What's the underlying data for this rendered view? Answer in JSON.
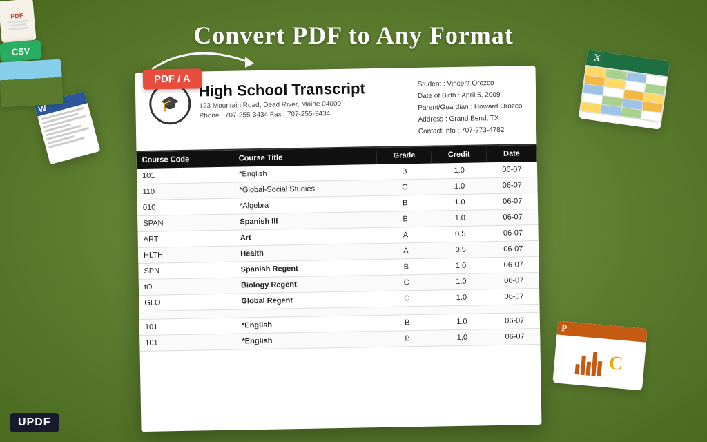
{
  "page": {
    "title": "Convert PDF to Any Format",
    "bg_color": "#6b8c3e",
    "logo_label": "UPDF"
  },
  "pdf_badge": "PDF / A",
  "transcript": {
    "title": "High School Transcript",
    "address": "123 Mountain Road, Dead River, Maine 04000",
    "phone": "Phone : 707-255-3434   Fax : 707-255-3434",
    "student": {
      "name": "Student : Vincent Orozco",
      "dob": "Date of Birth : April 5, 2009",
      "guardian": "Parent/Guardian : Howard Orozco",
      "address": "Address : Grand Bend, TX",
      "contact": "Contact Info : 707-273-4782"
    },
    "table": {
      "headers": [
        "Course Code",
        "Course Title",
        "Grade",
        "Credit",
        "Date"
      ],
      "rows": [
        [
          "101",
          "*English",
          "B",
          "1.0",
          "06-07"
        ],
        [
          "110",
          "*Global-Social Studies",
          "C",
          "1.0",
          "06-07"
        ],
        [
          "010",
          "*Algebra",
          "B",
          "1.0",
          "06-07"
        ],
        [
          "SPAN",
          "Spanish III",
          "B",
          "1.0",
          "06-07"
        ],
        [
          "ART",
          "Art",
          "A",
          "0.5",
          "06-07"
        ],
        [
          "HLTH",
          "Health",
          "A",
          "0.5",
          "06-07"
        ],
        [
          "SPN",
          "Spanish Regent",
          "B",
          "1.0",
          "06-07"
        ],
        [
          "tO",
          "Biology Regent",
          "C",
          "1.0",
          "06-07"
        ],
        [
          "GLO",
          "Global Regent",
          "C",
          "1.0",
          "06-07"
        ],
        [
          "",
          "",
          "",
          "",
          ""
        ],
        [
          "101",
          "*English",
          "B",
          "1.0",
          "06-07"
        ],
        [
          "101",
          "*English",
          "B",
          "1.0",
          "06-07"
        ]
      ]
    }
  }
}
